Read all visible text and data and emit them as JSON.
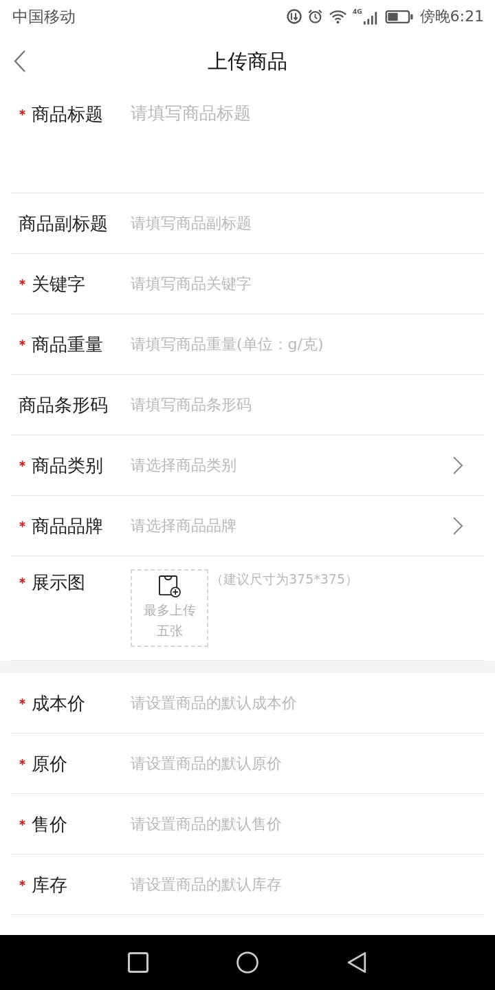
{
  "status_bar": {
    "carrier": "中国移动",
    "network_type": "4G",
    "time": "傍晚6:21"
  },
  "header": {
    "title": "上传商品"
  },
  "sections": [
    {
      "fields": [
        {
          "kind": "textarea",
          "label": "商品标题",
          "required": true,
          "placeholder": "请填写商品标题"
        },
        {
          "kind": "text",
          "label": "商品副标题",
          "required": false,
          "placeholder": "请填写商品副标题"
        },
        {
          "kind": "text",
          "label": "关键字",
          "required": true,
          "placeholder": "请填写商品关键字"
        },
        {
          "kind": "text",
          "label": "商品重量",
          "required": true,
          "placeholder": "请填写商品重量(单位：g/克)"
        },
        {
          "kind": "text",
          "label": "商品条形码",
          "required": false,
          "placeholder": "请填写商品条形码"
        },
        {
          "kind": "picker",
          "label": "商品类别",
          "required": true,
          "placeholder": "请选择商品类别"
        },
        {
          "kind": "picker",
          "label": "商品品牌",
          "required": true,
          "placeholder": "请选择商品品牌"
        },
        {
          "kind": "image",
          "label": "展示图",
          "required": true,
          "upload_text": "最多上传五张",
          "hint": "（建议尺寸为375*375）"
        }
      ]
    },
    {
      "fields": [
        {
          "kind": "text",
          "label": "成本价",
          "required": true,
          "placeholder": "请设置商品的默认成本价"
        },
        {
          "kind": "text",
          "label": "原价",
          "required": true,
          "placeholder": "请设置商品的默认原价"
        },
        {
          "kind": "text",
          "label": "售价",
          "required": true,
          "placeholder": "请设置商品的默认售价"
        },
        {
          "kind": "text",
          "label": "库存",
          "required": true,
          "placeholder": "请设置商品的默认库存"
        }
      ]
    }
  ]
}
